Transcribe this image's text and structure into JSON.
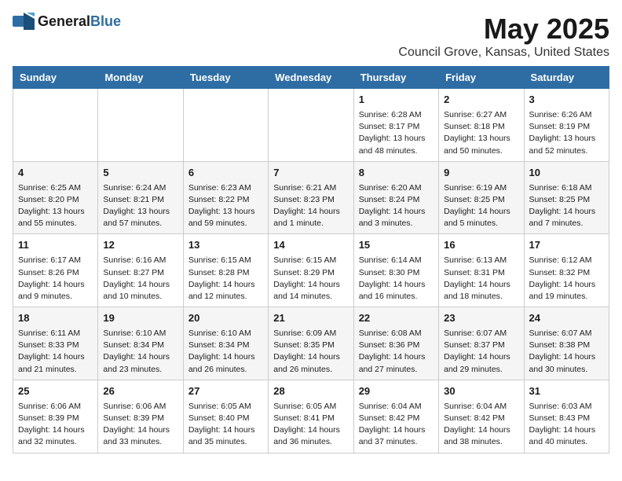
{
  "header": {
    "logo_general": "General",
    "logo_blue": "Blue",
    "month": "May 2025",
    "location": "Council Grove, Kansas, United States"
  },
  "weekdays": [
    "Sunday",
    "Monday",
    "Tuesday",
    "Wednesday",
    "Thursday",
    "Friday",
    "Saturday"
  ],
  "weeks": [
    [
      {
        "day": "",
        "content": ""
      },
      {
        "day": "",
        "content": ""
      },
      {
        "day": "",
        "content": ""
      },
      {
        "day": "",
        "content": ""
      },
      {
        "day": "1",
        "content": "Sunrise: 6:28 AM\nSunset: 8:17 PM\nDaylight: 13 hours\nand 48 minutes."
      },
      {
        "day": "2",
        "content": "Sunrise: 6:27 AM\nSunset: 8:18 PM\nDaylight: 13 hours\nand 50 minutes."
      },
      {
        "day": "3",
        "content": "Sunrise: 6:26 AM\nSunset: 8:19 PM\nDaylight: 13 hours\nand 52 minutes."
      }
    ],
    [
      {
        "day": "4",
        "content": "Sunrise: 6:25 AM\nSunset: 8:20 PM\nDaylight: 13 hours\nand 55 minutes."
      },
      {
        "day": "5",
        "content": "Sunrise: 6:24 AM\nSunset: 8:21 PM\nDaylight: 13 hours\nand 57 minutes."
      },
      {
        "day": "6",
        "content": "Sunrise: 6:23 AM\nSunset: 8:22 PM\nDaylight: 13 hours\nand 59 minutes."
      },
      {
        "day": "7",
        "content": "Sunrise: 6:21 AM\nSunset: 8:23 PM\nDaylight: 14 hours\nand 1 minute."
      },
      {
        "day": "8",
        "content": "Sunrise: 6:20 AM\nSunset: 8:24 PM\nDaylight: 14 hours\nand 3 minutes."
      },
      {
        "day": "9",
        "content": "Sunrise: 6:19 AM\nSunset: 8:25 PM\nDaylight: 14 hours\nand 5 minutes."
      },
      {
        "day": "10",
        "content": "Sunrise: 6:18 AM\nSunset: 8:25 PM\nDaylight: 14 hours\nand 7 minutes."
      }
    ],
    [
      {
        "day": "11",
        "content": "Sunrise: 6:17 AM\nSunset: 8:26 PM\nDaylight: 14 hours\nand 9 minutes."
      },
      {
        "day": "12",
        "content": "Sunrise: 6:16 AM\nSunset: 8:27 PM\nDaylight: 14 hours\nand 10 minutes."
      },
      {
        "day": "13",
        "content": "Sunrise: 6:15 AM\nSunset: 8:28 PM\nDaylight: 14 hours\nand 12 minutes."
      },
      {
        "day": "14",
        "content": "Sunrise: 6:15 AM\nSunset: 8:29 PM\nDaylight: 14 hours\nand 14 minutes."
      },
      {
        "day": "15",
        "content": "Sunrise: 6:14 AM\nSunset: 8:30 PM\nDaylight: 14 hours\nand 16 minutes."
      },
      {
        "day": "16",
        "content": "Sunrise: 6:13 AM\nSunset: 8:31 PM\nDaylight: 14 hours\nand 18 minutes."
      },
      {
        "day": "17",
        "content": "Sunrise: 6:12 AM\nSunset: 8:32 PM\nDaylight: 14 hours\nand 19 minutes."
      }
    ],
    [
      {
        "day": "18",
        "content": "Sunrise: 6:11 AM\nSunset: 8:33 PM\nDaylight: 14 hours\nand 21 minutes."
      },
      {
        "day": "19",
        "content": "Sunrise: 6:10 AM\nSunset: 8:34 PM\nDaylight: 14 hours\nand 23 minutes."
      },
      {
        "day": "20",
        "content": "Sunrise: 6:10 AM\nSunset: 8:34 PM\nDaylight: 14 hours\nand 26 minutes."
      },
      {
        "day": "21",
        "content": "Sunrise: 6:09 AM\nSunset: 8:35 PM\nDaylight: 14 hours\nand 26 minutes."
      },
      {
        "day": "22",
        "content": "Sunrise: 6:08 AM\nSunset: 8:36 PM\nDaylight: 14 hours\nand 27 minutes."
      },
      {
        "day": "23",
        "content": "Sunrise: 6:07 AM\nSunset: 8:37 PM\nDaylight: 14 hours\nand 29 minutes."
      },
      {
        "day": "24",
        "content": "Sunrise: 6:07 AM\nSunset: 8:38 PM\nDaylight: 14 hours\nand 30 minutes."
      }
    ],
    [
      {
        "day": "25",
        "content": "Sunrise: 6:06 AM\nSunset: 8:39 PM\nDaylight: 14 hours\nand 32 minutes."
      },
      {
        "day": "26",
        "content": "Sunrise: 6:06 AM\nSunset: 8:39 PM\nDaylight: 14 hours\nand 33 minutes."
      },
      {
        "day": "27",
        "content": "Sunrise: 6:05 AM\nSunset: 8:40 PM\nDaylight: 14 hours\nand 35 minutes."
      },
      {
        "day": "28",
        "content": "Sunrise: 6:05 AM\nSunset: 8:41 PM\nDaylight: 14 hours\nand 36 minutes."
      },
      {
        "day": "29",
        "content": "Sunrise: 6:04 AM\nSunset: 8:42 PM\nDaylight: 14 hours\nand 37 minutes."
      },
      {
        "day": "30",
        "content": "Sunrise: 6:04 AM\nSunset: 8:42 PM\nDaylight: 14 hours\nand 38 minutes."
      },
      {
        "day": "31",
        "content": "Sunrise: 6:03 AM\nSunset: 8:43 PM\nDaylight: 14 hours\nand 40 minutes."
      }
    ]
  ]
}
